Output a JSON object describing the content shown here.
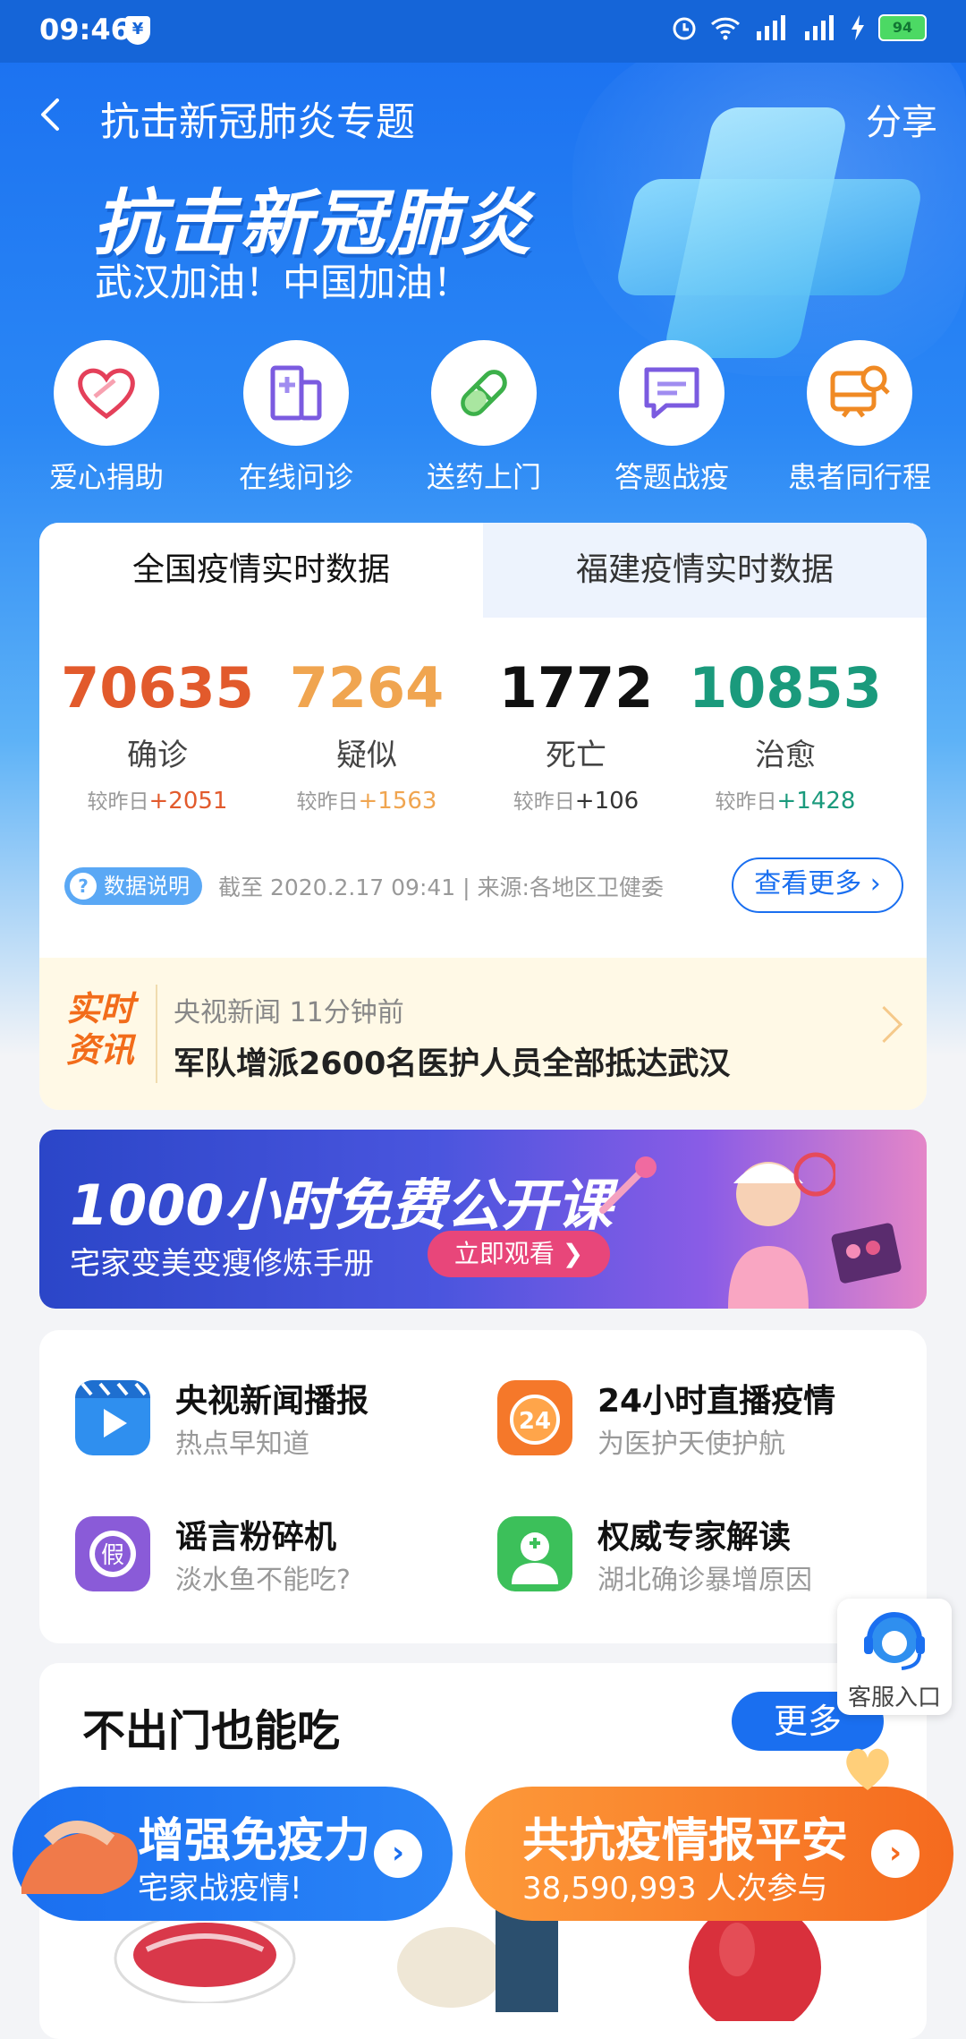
{
  "status_bar": {
    "time": "09:46",
    "shield": "¥",
    "network": "4G 4G",
    "battery": "94"
  },
  "header": {
    "title": "抗击新冠肺炎专题",
    "share": "分享"
  },
  "hero": {
    "title": "抗击新冠肺炎",
    "subtitle": "武汉加油！中国加油！"
  },
  "quick_actions": [
    {
      "label": "爱心捐助",
      "icon": "heart-icon"
    },
    {
      "label": "在线问诊",
      "icon": "hospital-icon"
    },
    {
      "label": "送药上门",
      "icon": "pill-icon"
    },
    {
      "label": "答题战疫",
      "icon": "quiz-icon"
    },
    {
      "label": "患者同行程",
      "icon": "train-search-icon"
    }
  ],
  "stats_card": {
    "tabs": [
      {
        "label": "全国疫情实时数据",
        "active": true
      },
      {
        "label": "福建疫情实时数据",
        "active": false
      }
    ],
    "stats": [
      {
        "value": "70635",
        "label": "确诊",
        "delta_prefix": "较昨日",
        "delta": "+2051",
        "color": "#e25a2c"
      },
      {
        "value": "7264",
        "label": "疑似",
        "delta_prefix": "较昨日",
        "delta": "+1563",
        "color": "#f0a550"
      },
      {
        "value": "1772",
        "label": "死亡",
        "delta_prefix": "较昨日",
        "delta": "+106",
        "color": "#111111"
      },
      {
        "value": "10853",
        "label": "治愈",
        "delta_prefix": "较昨日",
        "delta": "+1428",
        "color": "#1a9a7c"
      }
    ],
    "note_badge": "数据说明",
    "note_text": "截至 2020.2.17 09:41 | 来源:各地区卫健委",
    "more": "查看更多 ›",
    "news": {
      "badge_line1": "实时",
      "badge_line2": "资讯",
      "source": "央视新闻 11分钟前",
      "title": "军队增派2600名医护人员全部抵达武汉"
    }
  },
  "banner": {
    "title": "1000小时免费公开课",
    "subtitle": "宅家变美变瘦修炼手册",
    "button": "立即观看 ❯"
  },
  "services": [
    {
      "title": "央视新闻播报",
      "subtitle": "热点早知道",
      "icon": "video-play-icon",
      "color": "#2f8fef"
    },
    {
      "title": "24小时直播疫情",
      "subtitle": "为医护天使护航",
      "icon": "clock-24-icon",
      "color": "#f5782a"
    },
    {
      "title": "谣言粉碎机",
      "subtitle": "淡水鱼不能吃?",
      "icon": "fake-badge-icon",
      "color": "#8a5bd8"
    },
    {
      "title": "权威专家解读",
      "subtitle": "湖北确诊暴增原因",
      "icon": "doctor-icon",
      "color": "#3cc05a"
    }
  ],
  "customer_service": {
    "label": "客服入口"
  },
  "section": {
    "title": "不出门也能吃",
    "more": "更多"
  },
  "float_buttons": [
    {
      "title": "增强免疫力",
      "subtitle": "宅家战疫情!",
      "arrow": "›"
    },
    {
      "title": "共抗疫情报平安",
      "subtitle": "38,590,993 人次参与",
      "arrow": "›"
    }
  ]
}
